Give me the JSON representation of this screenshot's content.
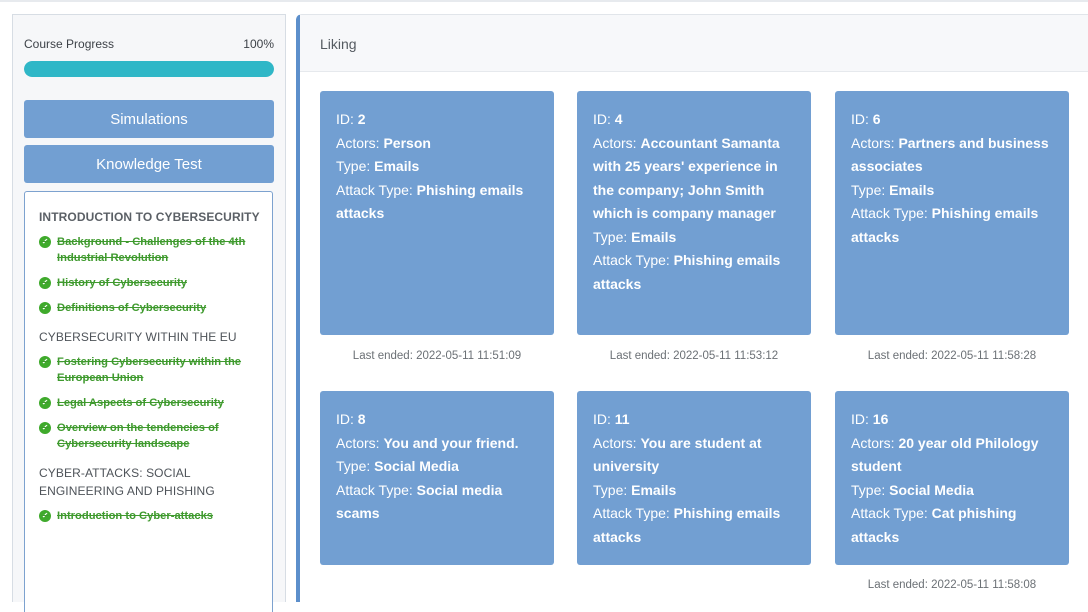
{
  "sidebar": {
    "progress": {
      "label": "Course Progress",
      "value_text": "100%",
      "value": 100
    },
    "buttons": {
      "simulations": "Simulations",
      "knowledge_test": "Knowledge Test"
    },
    "sections": [
      {
        "title": "INTRODUCTION TO CYBERSECURITY",
        "lessons": [
          "Background - Challenges of the 4th Industrial Revolution",
          "History of Cybersecurity",
          "Definitions of Cybersecurity"
        ]
      },
      {
        "title": "CYBERSECURITY WITHIN THE EU",
        "lessons": [
          "Fostering Cybersecurity within the European Union",
          "Legal Aspects of Cybersecurity",
          "Overview on the tendencies of Cybersecurity landscape"
        ]
      },
      {
        "title": "CYBER-ATTACKS: SOCIAL ENGINEERING AND PHISHING",
        "lessons": [
          "Introduction to Cyber-attacks"
        ]
      }
    ]
  },
  "main": {
    "title": "Liking",
    "labels": {
      "id": "ID:",
      "actors": "Actors:",
      "type": "Type:",
      "attack_type": "Attack Type:"
    },
    "cards": [
      {
        "id": "2",
        "actors": "Person",
        "type": "Emails",
        "attack_type": "Phishing emails attacks",
        "last_ended": "Last ended: 2022-05-11 11:51:09"
      },
      {
        "id": "4",
        "actors": "Accountant Samanta with 25 years' experience in the company; John Smith which is company manager",
        "type": "Emails",
        "attack_type": "Phishing emails attacks",
        "last_ended": "Last ended: 2022-05-11 11:53:12"
      },
      {
        "id": "6",
        "actors": "Partners and business associates",
        "type": "Emails",
        "attack_type": "Phishing emails attacks",
        "last_ended": "Last ended: 2022-05-11 11:58:28"
      },
      {
        "id": "8",
        "actors": "You and your friend.",
        "type": "Social Media",
        "attack_type": "Social media scams",
        "last_ended": ""
      },
      {
        "id": "11",
        "actors": "You are student at university",
        "type": "Emails",
        "attack_type": "Phishing emails attacks",
        "last_ended": ""
      },
      {
        "id": "16",
        "actors": "20 year old Philology student",
        "type": "Social Media",
        "attack_type": "Cat phishing attacks",
        "last_ended": "Last ended: 2022-05-11 11:58:08"
      }
    ]
  },
  "colors": {
    "accent": "#729fd2",
    "progress": "#2fb7c7",
    "done": "#3f9a2e"
  },
  "icons": {
    "lesson_status": "check-circle-icon"
  }
}
